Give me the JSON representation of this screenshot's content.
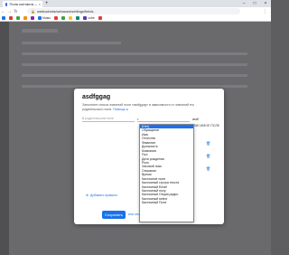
{
  "browser": {
    "tab_title": "Поля контакта — Web Loc",
    "tab_close": "×",
    "new_tab": "+",
    "url": "weblocbeta/webaxes/settings/fields",
    "controls": {
      "min": "–",
      "max": "□",
      "close": "×"
    },
    "bookmarks": [
      {
        "label": "",
        "color": "#1a73e8"
      },
      {
        "label": "",
        "color": "#e53935"
      },
      {
        "label": "",
        "color": "#43a047"
      },
      {
        "label": "",
        "color": "#fb8c00"
      },
      {
        "label": "",
        "color": "#8e24aa"
      },
      {
        "label": "Мамо",
        "color": "#1a73e8"
      },
      {
        "label": "",
        "color": "#e53935"
      },
      {
        "label": "",
        "color": "#43a047"
      },
      {
        "label": "",
        "color": "#fbc02d"
      },
      {
        "label": "",
        "color": "#00897b"
      },
      {
        "label": "cutie",
        "color": "#5e35b1"
      },
      {
        "label": "",
        "color": "#e53935"
      }
    ]
  },
  "modal": {
    "title": "asdfggag",
    "description": "Заполните список значений поля «asdfggag» в зависимости от значений его родительского поля.",
    "help_link": "Помощь",
    "parent_field_placeholder": "В родительском поле",
    "selected_value": "asdf",
    "column_label": "ЗАВИСИМОЕ ПОЛЕ",
    "add_link": "Добавить правило",
    "save_label": "Сохранить",
    "cancel_label": "или отменить"
  },
  "dropdown": {
    "selected_index": 0,
    "options": [
      "(Нет)",
      "Обращение",
      "Имя",
      "Отчество",
      "Фамилия",
      "Должность",
      "Компания",
      "Пол",
      "Дата рождения",
      "Роль",
      "Часовой пояс",
      "Описание",
      "Время",
      "Кастомное поле",
      "Кастомный строка текста",
      "Кастомный Email",
      "Кастомный полу",
      "Кастомный Опция радио",
      "Кастомный select",
      "Кастомный Поле"
    ]
  },
  "colors": {
    "accent": "#1a73e8",
    "selection": "#1e6ff0"
  }
}
